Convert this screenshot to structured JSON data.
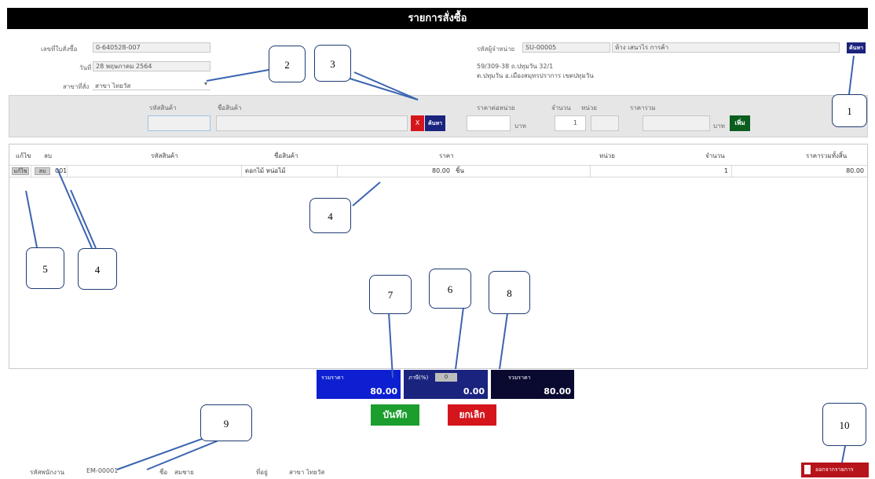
{
  "window": {
    "title": "รายการสั่งซื้อ"
  },
  "header_left": {
    "order_no_label": "เลขที่ใบสั่งซื้อ",
    "order_no_value": "0-640528-007",
    "date_label": "วันที่",
    "date_value": "28 พฤษภาคม 2564",
    "branch_label": "สาขาที่สั่ง",
    "branch_value": "สาขา ไทยวัส"
  },
  "header_right": {
    "supplier_label": "รหัสผู้จำหน่าย",
    "supplier_code": "SU-00005",
    "supplier_name": "ห้าง เสนาไร การค้า",
    "search_button": "ค้นหา",
    "address_line1": "59/309-38 ถ.ปทุมวัน 32/1",
    "address_line2": "ต.ปทุมวัน อ.เมืองสมุทรปราการ เขตปทุมวัน"
  },
  "entry": {
    "product_code_label": "รหัสสินค้า",
    "product_name_label": "ชื่อสินค้า",
    "search_button": "ค้นหา",
    "clear_button": "X",
    "price_label": "ราคาต่อหน่วย",
    "price_unit": "บาท",
    "qty_label": "จำนวน",
    "unit_label": "หน่วย",
    "total_label": "ราคารวม",
    "total_unit": "บาท",
    "add_button": "เพิ่ม",
    "qty_value": "1"
  },
  "grid": {
    "headers": [
      "แก้ไข",
      "ลบ",
      "รหัสสินค้า",
      "ชื่อสินค้า",
      "ราคา",
      "หน่วย",
      "จำนวน",
      "ราคารวมทั้งสิ้น"
    ],
    "rows": [
      {
        "edit": "แก้ไข",
        "delete": "ลบ",
        "code": "001",
        "name": "ดอกไม้ หน่อไม้",
        "price": "80.00",
        "unit": "ชิ้น",
        "qty": "1",
        "total": "80.00"
      }
    ]
  },
  "totals": {
    "subtotal_label": "รวมราคา",
    "subtotal_value": "80.00",
    "vat_label": "ภาษี(%)",
    "vat_rate": "0",
    "vat_value": "0.00",
    "grand_label": "รวมราคา",
    "grand_value": "80.00"
  },
  "actions": {
    "save": "บันทึก",
    "cancel": "ยกเลิก",
    "back": "ออกจากรายการ"
  },
  "footer": {
    "employee_label": "รหัสพนักงาน",
    "employee_value": "EM-00001",
    "name_label": "ชื่อ",
    "name_value": "สมชาย",
    "position_label": "ที่อยู่",
    "position_value": "สาขา ไทยวัส"
  },
  "callouts": [
    "1",
    "2",
    "3",
    "4",
    "4",
    "5",
    "6",
    "7",
    "8",
    "9",
    "10"
  ],
  "colors": {
    "title_bg": "#000000",
    "navy": "#1a237e",
    "blue": "#0d1fd1",
    "green": "#1b9e2e",
    "red": "#d5151c",
    "dark_green": "#0b5d1e"
  }
}
